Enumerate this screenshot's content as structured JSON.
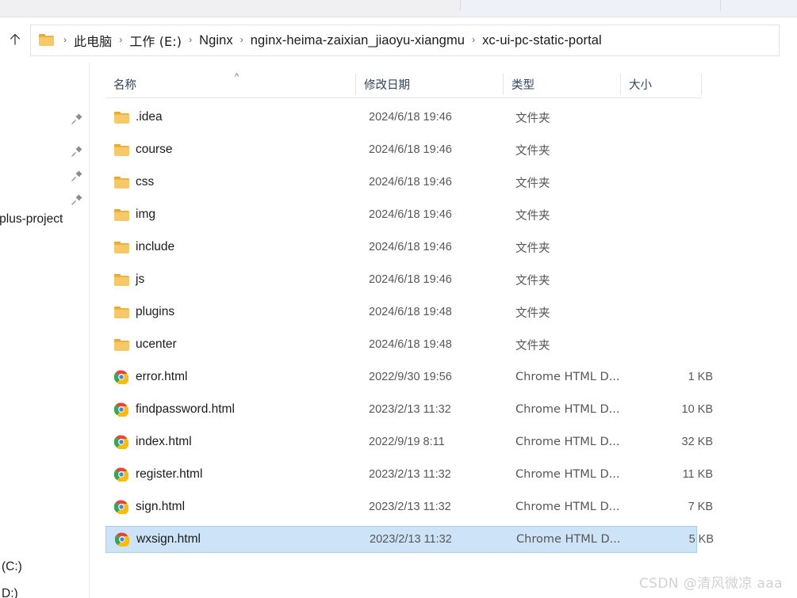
{
  "toolbar": {
    "icons": [
      {
        "name": "pin-quick-access-icon",
        "kind": "blue-small"
      },
      {
        "name": "cut-icon",
        "kind": "bar-dark"
      },
      {
        "name": "copy-icon",
        "kind": "bar-light"
      },
      {
        "name": "paste-icon",
        "kind": "bar-light2"
      },
      {
        "name": "rename-icon",
        "kind": "blue-block"
      },
      {
        "name": "delete-icon",
        "kind": "bar-dark"
      }
    ]
  },
  "navigation": {
    "up_button_label": "↑",
    "folder_icon": "folder-icon",
    "breadcrumbs": [
      {
        "label": "此电脑"
      },
      {
        "label": "工作 (E:)"
      },
      {
        "label": "Nginx"
      },
      {
        "label": "nginx-heima-zaixian_jiaoyu-xiangmu"
      },
      {
        "label": "xc-ui-pc-static-portal"
      }
    ],
    "separator": "›"
  },
  "columns": {
    "name": "名称",
    "date_modified": "修改日期",
    "type": "类型",
    "size": "大小",
    "sort_indicator": "^",
    "sort_column": "名称",
    "sort_direction": "ascending"
  },
  "sidebar": {
    "pins": [
      {
        "name": "pin-icon-1"
      },
      {
        "name": "pin-icon-2"
      },
      {
        "name": "pin-icon-3"
      },
      {
        "name": "pin-icon-4"
      }
    ],
    "clipped_labels": [
      {
        "label": "-plus-project"
      },
      {
        "label": "(C:)"
      },
      {
        "label": "D:)"
      }
    ]
  },
  "files": [
    {
      "name": ".idea",
      "date": "2024/6/18 19:46",
      "type": "文件夹",
      "size": "",
      "icon": "folder-icon",
      "selected": false
    },
    {
      "name": "course",
      "date": "2024/6/18 19:46",
      "type": "文件夹",
      "size": "",
      "icon": "folder-icon",
      "selected": false
    },
    {
      "name": "css",
      "date": "2024/6/18 19:46",
      "type": "文件夹",
      "size": "",
      "icon": "folder-icon",
      "selected": false
    },
    {
      "name": "img",
      "date": "2024/6/18 19:46",
      "type": "文件夹",
      "size": "",
      "icon": "folder-icon",
      "selected": false
    },
    {
      "name": "include",
      "date": "2024/6/18 19:46",
      "type": "文件夹",
      "size": "",
      "icon": "folder-icon",
      "selected": false
    },
    {
      "name": "js",
      "date": "2024/6/18 19:46",
      "type": "文件夹",
      "size": "",
      "icon": "folder-icon",
      "selected": false
    },
    {
      "name": "plugins",
      "date": "2024/6/18 19:48",
      "type": "文件夹",
      "size": "",
      "icon": "folder-icon",
      "selected": false
    },
    {
      "name": "ucenter",
      "date": "2024/6/18 19:48",
      "type": "文件夹",
      "size": "",
      "icon": "folder-icon",
      "selected": false
    },
    {
      "name": "error.html",
      "date": "2022/9/30 19:56",
      "type": "Chrome HTML D...",
      "size": "1 KB",
      "icon": "chrome-icon",
      "selected": false
    },
    {
      "name": "findpassword.html",
      "date": "2023/2/13 11:32",
      "type": "Chrome HTML D...",
      "size": "10 KB",
      "icon": "chrome-icon",
      "selected": false
    },
    {
      "name": "index.html",
      "date": "2022/9/19 8:11",
      "type": "Chrome HTML D...",
      "size": "32 KB",
      "icon": "chrome-icon",
      "selected": false
    },
    {
      "name": "register.html",
      "date": "2023/2/13 11:32",
      "type": "Chrome HTML D...",
      "size": "11 KB",
      "icon": "chrome-icon",
      "selected": false
    },
    {
      "name": "sign.html",
      "date": "2023/2/13 11:32",
      "type": "Chrome HTML D...",
      "size": "7 KB",
      "icon": "chrome-icon",
      "selected": false
    },
    {
      "name": "wxsign.html",
      "date": "2023/2/13 11:32",
      "type": "Chrome HTML D...",
      "size": "5 KB",
      "icon": "chrome-icon",
      "selected": true
    }
  ],
  "watermark": {
    "text": "CSDN @清风微凉 aaa"
  },
  "colors": {
    "selection_fill": "#cce3f8",
    "selection_border": "#a7cdee",
    "header_text": "#30455e",
    "folder_yellow": "#f7c867",
    "toolbar_bg": "#f0f0f2"
  }
}
